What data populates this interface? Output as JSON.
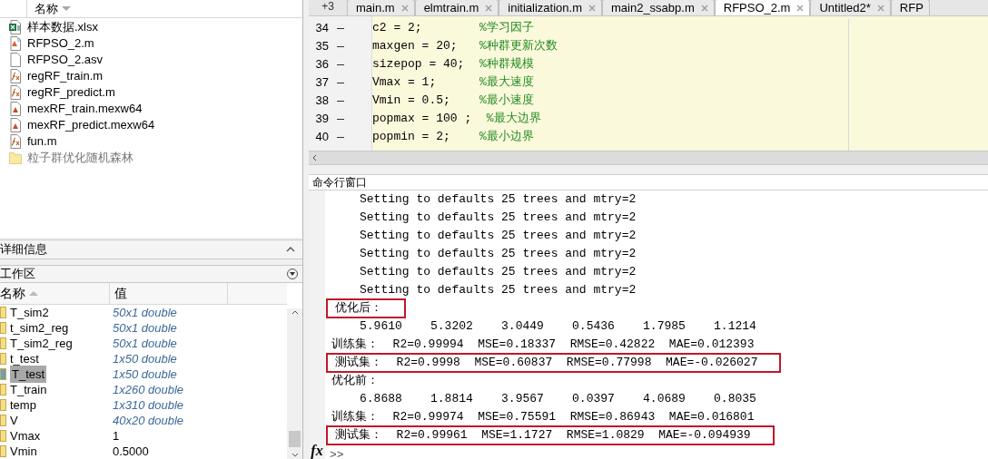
{
  "file_browser": {
    "column": "名称",
    "files": [
      {
        "name": "样本数据.xlsx",
        "kind": "excel"
      },
      {
        "name": "RFPSO_2.m",
        "kind": "script"
      },
      {
        "name": "RFPSO_2.asv",
        "kind": "blank"
      },
      {
        "name": "regRF_train.m",
        "kind": "function"
      },
      {
        "name": "regRF_predict.m",
        "kind": "function"
      },
      {
        "name": "mexRF_train.mexw64",
        "kind": "mex"
      },
      {
        "name": "mexRF_predict.mexw64",
        "kind": "mex"
      },
      {
        "name": "fun.m",
        "kind": "function"
      },
      {
        "name": "粒子群优化随机森林",
        "kind": "folder"
      }
    ]
  },
  "details": {
    "title": "详细信息"
  },
  "workspace": {
    "title": "工作区",
    "columns": [
      "名称",
      "值"
    ],
    "rows": [
      {
        "name": "T_sim2",
        "value": "50x1 double",
        "kind": "matrix",
        "selected": false
      },
      {
        "name": "t_sim2_reg",
        "value": "50x1 double",
        "kind": "matrix",
        "selected": false
      },
      {
        "name": "T_sim2_reg",
        "value": "50x1 double",
        "kind": "matrix",
        "selected": false
      },
      {
        "name": "t_test",
        "value": "1x50 double",
        "kind": "matrix",
        "selected": false
      },
      {
        "name": "T_test",
        "value": "1x50 double",
        "kind": "matrix",
        "selected": true
      },
      {
        "name": "T_train",
        "value": "1x260 double",
        "kind": "matrix",
        "selected": false
      },
      {
        "name": "temp",
        "value": "1x310 double",
        "kind": "matrix",
        "selected": false
      },
      {
        "name": "V",
        "value": "40x20 double",
        "kind": "matrix",
        "selected": false
      },
      {
        "name": "Vmax",
        "value": "1",
        "kind": "scalar",
        "selected": false
      },
      {
        "name": "Vmin",
        "value": "0.5000",
        "kind": "scalar",
        "selected": false
      }
    ]
  },
  "editor": {
    "overflow": "+3",
    "tabs": [
      {
        "label": "main.m",
        "selected": false,
        "closable": true
      },
      {
        "label": "elmtrain.m",
        "selected": false,
        "closable": true
      },
      {
        "label": "initialization.m",
        "selected": false,
        "closable": true
      },
      {
        "label": "main2_ssabp.m",
        "selected": false,
        "closable": true
      },
      {
        "label": "RFPSO_2.m",
        "selected": true,
        "closable": true
      },
      {
        "label": "Untitled2*",
        "selected": false,
        "closable": true
      },
      {
        "label": "RFP",
        "selected": false,
        "closable": false
      }
    ],
    "lines": [
      {
        "number": "34",
        "code": "c2 = 2;",
        "comment": "%学习因子"
      },
      {
        "number": "35",
        "code": "maxgen = 20;",
        "comment": "%种群更新次数"
      },
      {
        "number": "36",
        "code": "sizepop = 40;",
        "comment": "%种群规模"
      },
      {
        "number": "37",
        "code": "Vmax = 1;",
        "comment": "%最大速度"
      },
      {
        "number": "38",
        "code": "Vmin = 0.5;",
        "comment": "%最小速度"
      },
      {
        "number": "39",
        "code": "popmax = 100 ;",
        "comment": " %最大边界"
      },
      {
        "number": "40",
        "code": "popmin = 2;",
        "comment": "%最小边界"
      }
    ]
  },
  "command_window": {
    "title": "命令行窗口",
    "function_button": "fx",
    "prompt": ">>",
    "output": [
      {
        "text": "Setting to defaults 25 trees and mtry=2",
        "kind": "indented",
        "highlighted": false
      },
      {
        "text": "Setting to defaults 25 trees and mtry=2",
        "kind": "indented",
        "highlighted": false
      },
      {
        "text": "Setting to defaults 25 trees and mtry=2",
        "kind": "indented",
        "highlighted": false
      },
      {
        "text": "Setting to defaults 25 trees and mtry=2",
        "kind": "indented",
        "highlighted": false
      },
      {
        "text": "Setting to defaults 25 trees and mtry=2",
        "kind": "indented",
        "highlighted": false
      },
      {
        "text": "Setting to defaults 25 trees and mtry=2",
        "kind": "indented",
        "highlighted": false
      },
      {
        "text": "优化后：",
        "kind": "plain",
        "highlighted": true
      },
      {
        "text": "5.9610    5.3202    3.0449    0.5436    1.7985    1.1214",
        "kind": "indented",
        "highlighted": false
      },
      {
        "text": "训练集：  R2=0.99994  MSE=0.18337  RMSE=0.42822  MAE=0.012393",
        "kind": "plain",
        "highlighted": false
      },
      {
        "text": "测试集：  R2=0.9998  MSE=0.60837  RMSE=0.77998  MAE=-0.026027",
        "kind": "plain",
        "highlighted": true
      },
      {
        "text": "优化前：",
        "kind": "plain",
        "highlighted": false
      },
      {
        "text": "6.8688    1.8814    3.9567    0.0397    4.0689    0.8035",
        "kind": "indented",
        "highlighted": false
      },
      {
        "text": "训练集：  R2=0.99974  MSE=0.75591  RMSE=0.86943  MAE=0.016801",
        "kind": "plain",
        "highlighted": false
      },
      {
        "text": "测试集：  R2=0.99961  MSE=1.1727  RMSE=1.0829  MAE=-0.094939",
        "kind": "plain",
        "highlighted": true
      }
    ]
  }
}
